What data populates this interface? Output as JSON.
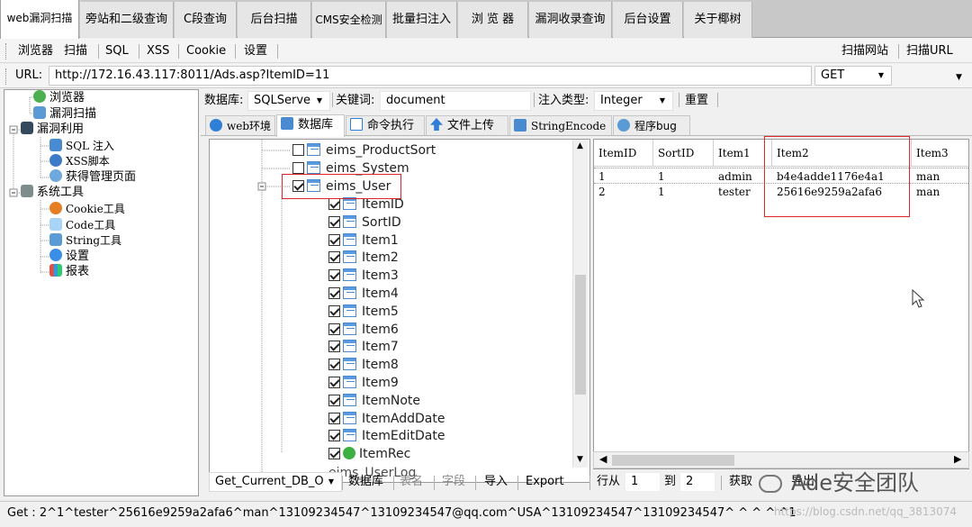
{
  "tabs": [
    "web漏洞扫描",
    "旁站和二级查询",
    "C段查询",
    "后台扫描",
    "CMS安全检测",
    "批量扫注入",
    "浏 览 器",
    "漏洞收录查询",
    "后台设置",
    "关于椰树"
  ],
  "toolbar": {
    "left": [
      "浏览器",
      "扫描",
      "SQL",
      "XSS",
      "Cookie",
      "设置"
    ],
    "right": [
      "扫描网站",
      "扫描URL"
    ]
  },
  "url": {
    "label": "URL:",
    "value": "http://172.16.43.117:8011/Ads.asp?ItemID=11",
    "method": "GET"
  },
  "left_tree": [
    {
      "label": "浏览器",
      "icon": "check-circle-icon"
    },
    {
      "label": "漏洞扫描",
      "icon": "scan-icon"
    },
    {
      "label": "漏洞利用",
      "icon": "exploit-icon"
    },
    {
      "label": "SQL 注入",
      "icon": "database-icon"
    },
    {
      "label": "XSS脚本",
      "icon": "x-circle-icon"
    },
    {
      "label": "获得管理页面",
      "icon": "user-icon"
    },
    {
      "label": "系统工具",
      "icon": "tools-icon"
    },
    {
      "label": "Cookie工具",
      "icon": "cookie-icon"
    },
    {
      "label": "Code工具",
      "icon": "code-icon"
    },
    {
      "label": "String工具",
      "icon": "string-icon"
    },
    {
      "label": "设置",
      "icon": "gear-icon"
    },
    {
      "label": "报表",
      "icon": "chart-icon"
    }
  ],
  "filters": {
    "db_label": "数据库:",
    "db_value": "SQLServe",
    "keyword_label": "关键词:",
    "keyword_value": "document",
    "inject_label": "注入类型:",
    "inject_value": "Integer",
    "reset": "重置"
  },
  "subtabs": [
    "web环境",
    "数据库",
    "命令执行",
    "文件上传",
    "StringEncode",
    "程序bug"
  ],
  "db_tree": {
    "tables_top": [
      "eims_ProductSort",
      "eims_System"
    ],
    "selected_table": "eims_User",
    "fields": [
      "ItemID",
      "SortID",
      "Item1",
      "Item2",
      "Item3",
      "Item4",
      "Item5",
      "Item6",
      "Item7",
      "Item8",
      "Item9",
      "ItemNote",
      "ItemAddDate",
      "ItemEditDate",
      "ItemRec"
    ],
    "partial_next": "eims_UserLog"
  },
  "grid": {
    "headers": [
      "ItemID",
      "SortID",
      "Item1",
      "Item2",
      "Item3"
    ],
    "rows": [
      [
        "1",
        "1",
        "admin",
        "b4e4adde1176e4a1",
        "man"
      ],
      [
        "2",
        "1",
        "tester",
        "25616e9259a2afa6",
        "man"
      ]
    ]
  },
  "bottom": {
    "method_value": "Get_Current_DB_O",
    "buttons": [
      "数据库",
      "表名",
      "字段",
      "导入",
      "Export"
    ],
    "row_from_label": "行从",
    "row_from": "1",
    "row_to_label": "到",
    "row_to": "2",
    "fetch": "获取",
    "export2": "导出"
  },
  "watermark": "Ade安全团队",
  "url_watermark": "https://blog.csdn.net/qq_3813074",
  "status": "Get : 2^1^tester^25616e9259a2afa6^man^13109234547^13109234547@qq.com^USA^13109234547^13109234547^ ^ ^ ^ ^1",
  "colors": {
    "highlight_box": "#e0262b",
    "accent_blue": "#2f7fd6"
  }
}
